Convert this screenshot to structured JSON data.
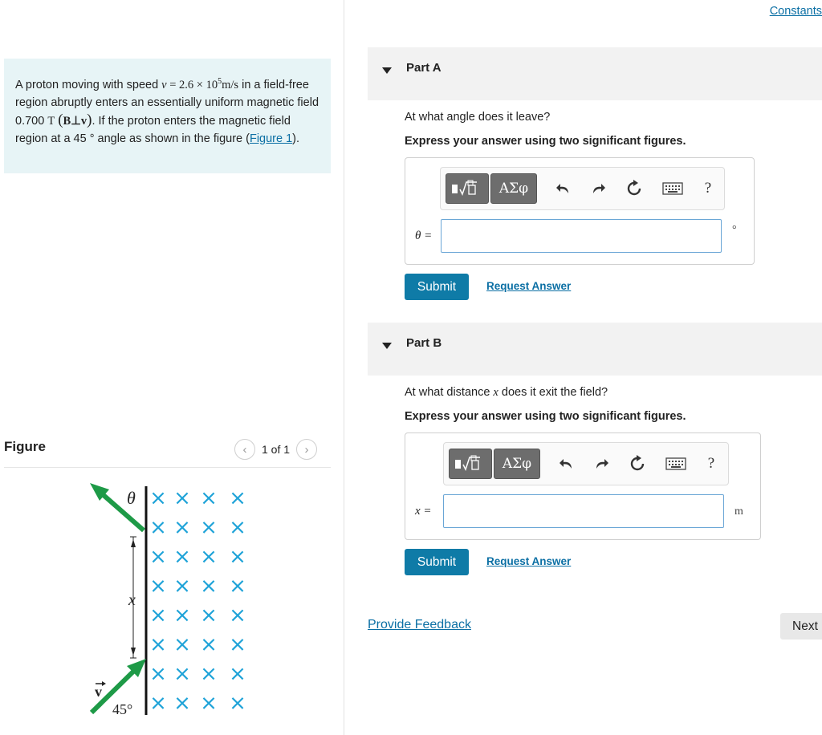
{
  "problem": {
    "text_1": "A proton moving with speed ",
    "speed_var": "v",
    "speed_eq": " = ",
    "speed_value": "2.6 × 10",
    "speed_exp": "5",
    "speed_unit": "m/s",
    "text_2": " in a field-free region abruptly enters an essentially uniform magnetic field 0.700 ",
    "field_unit": "T",
    "perp": "B⊥v",
    "text_3": ". If the proton enters the magnetic field region at a 45 ° angle as shown in the figure (",
    "figure_link": "Figure 1",
    "text_4": ")."
  },
  "figure_panel": {
    "title": "Figure",
    "pager_text": "1 of 1",
    "prev_icon": "chevron-left-icon",
    "next_icon": "chevron-right-icon",
    "labels": {
      "theta": "θ",
      "x": "x",
      "v": "v",
      "angle": "45°"
    },
    "field_symbol": "×",
    "field_color": "#1fa3d8",
    "arrow_color": "#1e9a47"
  },
  "header": {
    "constants_link": "Constants"
  },
  "parts": [
    {
      "label": "Part A",
      "question_prefix": "At what angle does it leave?",
      "question_var": "",
      "question_suffix": "",
      "instruction": "Express your answer using two significant figures.",
      "var_label": "θ =",
      "unit": "°",
      "submit_label": "Submit",
      "request_label": "Request Answer",
      "toolbar": {
        "templates_icon": "templates-icon",
        "symbols_label": "ΑΣφ"
      }
    },
    {
      "label": "Part B",
      "question_prefix": "At what distance ",
      "question_var": "x",
      "question_suffix": " does it exit the field?",
      "instruction": "Express your answer using two significant figures.",
      "var_label": "x =",
      "unit": "m",
      "submit_label": "Submit",
      "request_label": "Request Answer",
      "toolbar": {
        "templates_icon": "templates-icon",
        "symbols_label": "ΑΣφ"
      }
    }
  ],
  "toolbar_icons": [
    "undo-icon",
    "redo-icon",
    "reset-icon",
    "keyboard-icon",
    "help-icon"
  ],
  "help_glyph": "?",
  "footer": {
    "feedback_link": "Provide Feedback",
    "next_label": "Next"
  },
  "colors": {
    "accent": "#0f7ba7",
    "link": "#0b6fa4",
    "problem_bg": "#e7f4f6"
  }
}
